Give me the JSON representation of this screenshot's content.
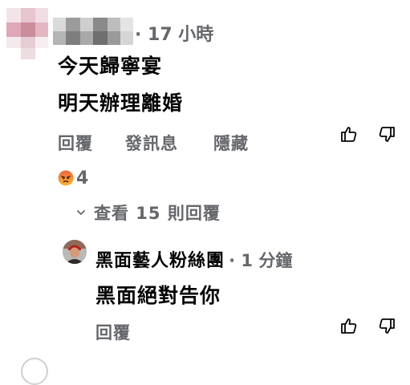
{
  "comment": {
    "time": "17 小時",
    "lines": [
      "今天歸寧宴",
      "明天辦理離婚"
    ],
    "actions": {
      "reply": "回覆",
      "message": "發訊息",
      "hide": "隱藏"
    },
    "reaction": {
      "emoji": "angry-emoji-icon",
      "count": "4"
    },
    "view_replies": "查看 15 則回覆"
  },
  "reply": {
    "author": "黑面藝人粉絲團",
    "time": "1 分鐘",
    "text": "黑面絕對告你",
    "actions": {
      "reply": "回覆"
    }
  },
  "colors": {
    "meta": "#65676b",
    "text": "#050505",
    "angry": "#f0643c"
  }
}
